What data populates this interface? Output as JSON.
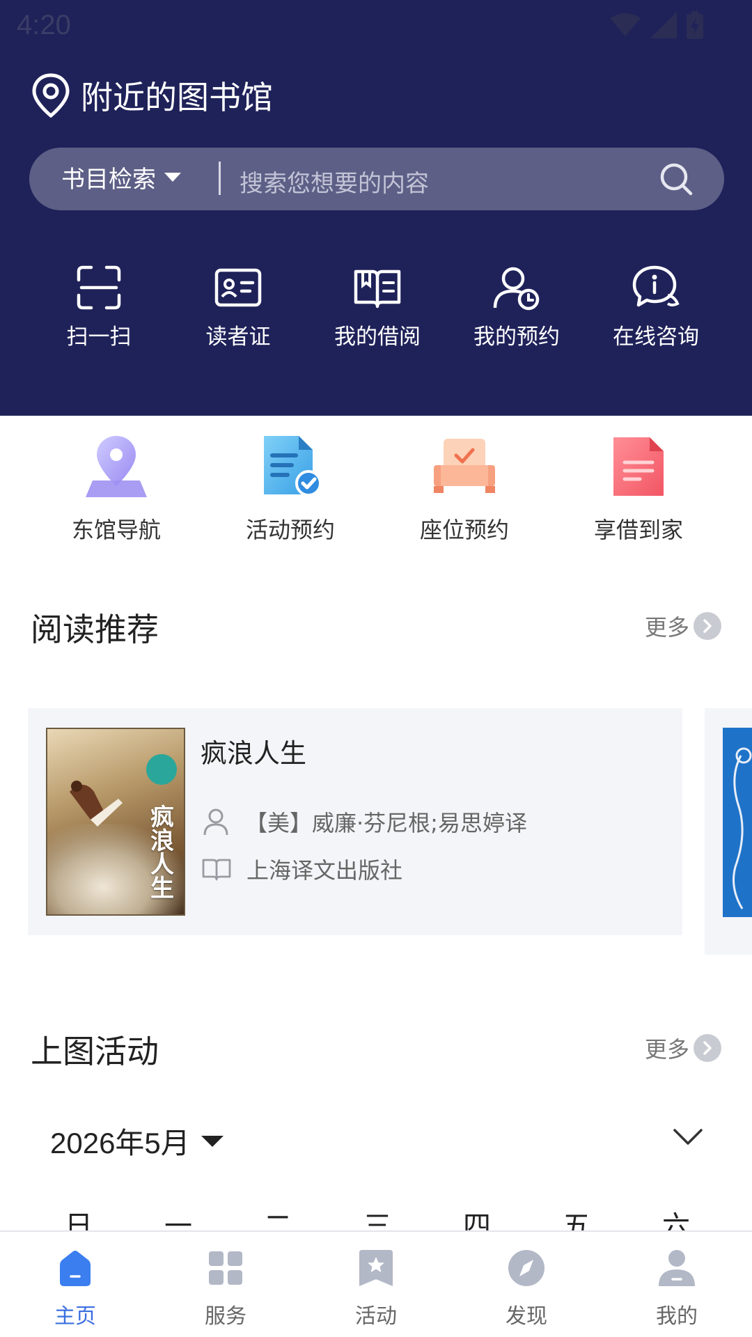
{
  "status": {
    "time": "4:20"
  },
  "header": {
    "location_label": "附近的图书馆",
    "search": {
      "type_label": "书目检索",
      "placeholder": "搜索您想要的内容"
    },
    "quick_actions": [
      {
        "label": "扫一扫",
        "icon": "scan-icon"
      },
      {
        "label": "读者证",
        "icon": "reader-card-icon"
      },
      {
        "label": "我的借阅",
        "icon": "borrow-book-icon"
      },
      {
        "label": "我的预约",
        "icon": "reservation-icon"
      },
      {
        "label": "在线咨询",
        "icon": "consult-chat-icon"
      }
    ]
  },
  "services": [
    {
      "label": "东馆导航",
      "icon": "map-pin-icon"
    },
    {
      "label": "活动预约",
      "icon": "doc-check-icon"
    },
    {
      "label": "座位预约",
      "icon": "seat-icon"
    },
    {
      "label": "享借到家",
      "icon": "delivery-doc-icon"
    }
  ],
  "reading": {
    "title": "阅读推荐",
    "more_label": "更多",
    "book": {
      "title": "疯浪人生",
      "author": "【美】威廉·芬尼根;易思婷译",
      "publisher": "上海译文出版社",
      "cover_text": "疯浪人生"
    }
  },
  "activities": {
    "title": "上图活动",
    "more_label": "更多",
    "month_label": "2026年5月",
    "weekdays": [
      "日",
      "一",
      "二",
      "三",
      "四",
      "五",
      "六"
    ]
  },
  "tabbar": {
    "items": [
      {
        "label": "主页",
        "icon": "home-icon",
        "active": true
      },
      {
        "label": "服务",
        "icon": "grid-icon"
      },
      {
        "label": "活动",
        "icon": "activity-star-icon"
      },
      {
        "label": "发现",
        "icon": "compass-icon"
      },
      {
        "label": "我的",
        "icon": "profile-icon"
      }
    ]
  },
  "colors": {
    "header_bg": "#1f2259",
    "search_bg": "#5d5f86",
    "accent": "#3b6fe0"
  }
}
